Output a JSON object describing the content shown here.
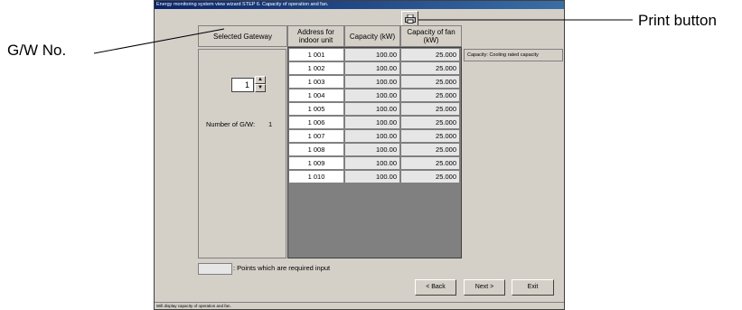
{
  "window": {
    "title": "Energy monitoring system view wizard   STEP 6. Capacity of operation and fan.",
    "status": "Will display capacity of operation and fan."
  },
  "header": {
    "gateway": "Selected Gateway",
    "address": "Address for indoor unit",
    "capacity": "Capacity (kW)",
    "fan_capacity": "Capacity of fan (kW)"
  },
  "gateway": {
    "number": "1",
    "count_label": "Number of G/W:",
    "count_value": "1"
  },
  "table": {
    "rows": [
      {
        "address": "1 001",
        "capacity": "100.00",
        "fan": "25.000"
      },
      {
        "address": "1 002",
        "capacity": "100.00",
        "fan": "25.000"
      },
      {
        "address": "1 003",
        "capacity": "100.00",
        "fan": "25.000"
      },
      {
        "address": "1 004",
        "capacity": "100.00",
        "fan": "25.000"
      },
      {
        "address": "1 005",
        "capacity": "100.00",
        "fan": "25.000"
      },
      {
        "address": "1 006",
        "capacity": "100.00",
        "fan": "25.000"
      },
      {
        "address": "1 007",
        "capacity": "100.00",
        "fan": "25.000"
      },
      {
        "address": "1 008",
        "capacity": "100.00",
        "fan": "25.000"
      },
      {
        "address": "1 009",
        "capacity": "100.00",
        "fan": "25.000"
      },
      {
        "address": "1 010",
        "capacity": "100.00",
        "fan": "25.000"
      }
    ]
  },
  "hint": "Capacity: Cooling rated capacity",
  "legend": ": Points which are required input",
  "buttons": {
    "back": "< Back",
    "next": "Next >",
    "exit": "Exit"
  },
  "callouts": {
    "gw_no": "G/W No.",
    "print": "Print button"
  },
  "icons": {
    "print": "printer-icon"
  }
}
